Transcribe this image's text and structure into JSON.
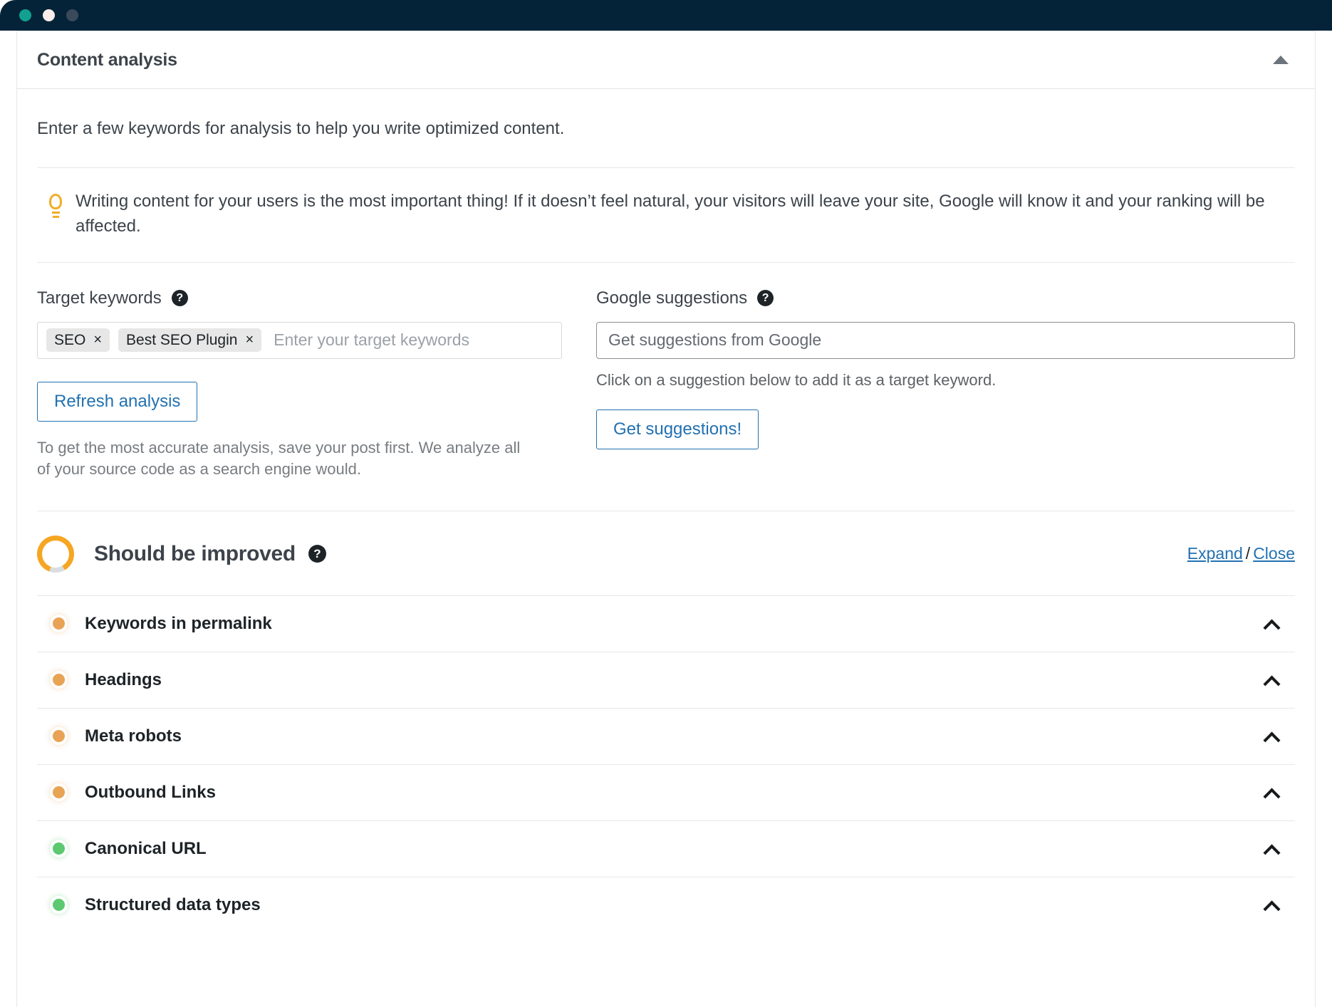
{
  "window": {
    "dots": [
      {
        "name": "window-dot-green",
        "color": "#12a091"
      },
      {
        "name": "window-dot-yellow",
        "color": "#fbeeea"
      },
      {
        "name": "window-dot-grey",
        "color": "#3b4a5a"
      }
    ]
  },
  "panel": {
    "title": "Content analysis",
    "collapse_icon": "caret-up-icon",
    "intro": "Enter a few keywords for analysis to help you write optimized content.",
    "tip": {
      "icon": "lightbulb-icon",
      "text": "Writing content for your users is the most important thing! If it doesn’t feel natural, your visitors will leave your site, Google will know it and your ranking will be affected."
    }
  },
  "target_keywords": {
    "label": "Target keywords",
    "help_icon": "help-circle-icon",
    "tags": [
      {
        "label": "SEO",
        "remove_icon": "×"
      },
      {
        "label": "Best SEO Plugin",
        "remove_icon": "×"
      }
    ],
    "placeholder": "Enter your target keywords",
    "refresh_button": "Refresh analysis",
    "hint": "To get the most accurate analysis, save your post first. We analyze all of your source code as a search engine would."
  },
  "google_suggestions": {
    "label": "Google suggestions",
    "help_icon": "help-circle-icon",
    "input_value": "",
    "placeholder": "Get suggestions from Google",
    "hint": "Click on a suggestion below to add it as a target keyword.",
    "button": "Get suggestions!"
  },
  "score": {
    "title": "Should be improved",
    "help_icon": "help-circle-icon",
    "ring_color": "#f5a623",
    "ring_track_color": "#d9dde0",
    "ring_percent": 86,
    "expand_link": "Expand",
    "separator": "/",
    "close_link": "Close"
  },
  "checks": [
    {
      "label": "Keywords in permalink",
      "status": "orange",
      "chevron": "chevron-up-icon"
    },
    {
      "label": "Headings",
      "status": "orange",
      "chevron": "chevron-up-icon"
    },
    {
      "label": "Meta robots",
      "status": "orange",
      "chevron": "chevron-up-icon"
    },
    {
      "label": "Outbound Links",
      "status": "orange",
      "chevron": "chevron-up-icon"
    },
    {
      "label": "Canonical URL",
      "status": "green",
      "chevron": "chevron-up-icon"
    },
    {
      "label": "Structured data types",
      "status": "green",
      "chevron": "chevron-up-icon"
    }
  ],
  "colors": {
    "titlebar": "#042338",
    "link": "#2271b1",
    "status_orange": "#e8a355",
    "status_green": "#5cc971",
    "accent_amber": "#f0ad26"
  }
}
